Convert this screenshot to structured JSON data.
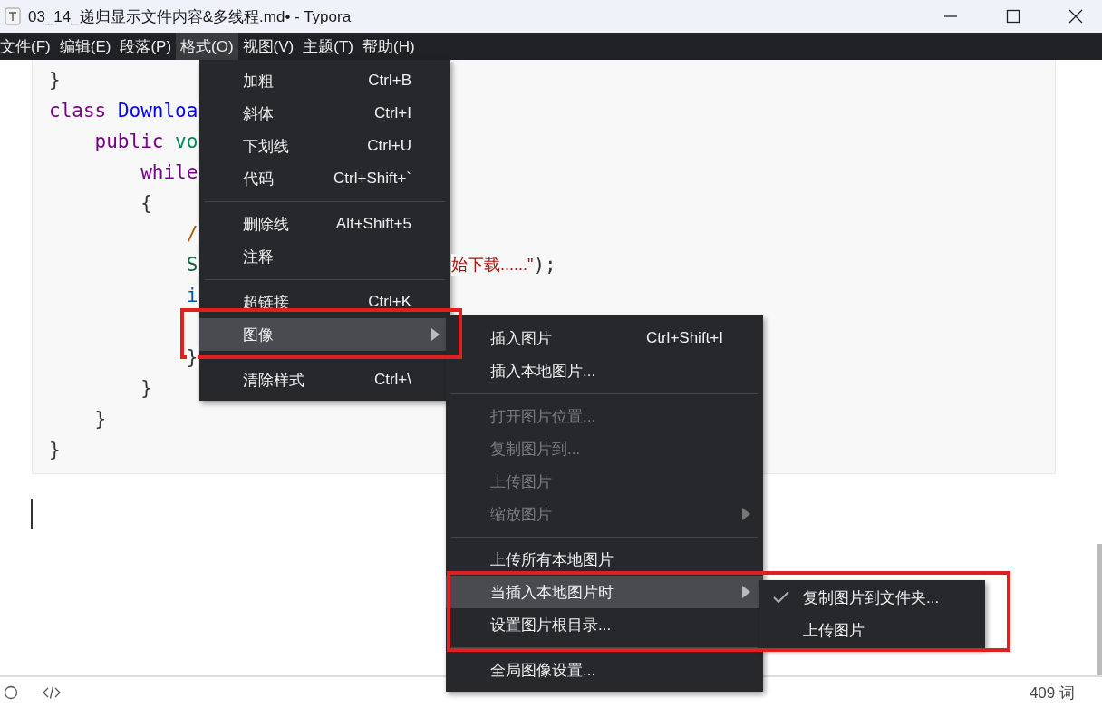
{
  "window": {
    "title": "03_14_递归显示文件内容&多线程.md• - Typora"
  },
  "menu_bar": [
    {
      "label": "文件(F)",
      "selected": false
    },
    {
      "label": "编辑(E)",
      "selected": false
    },
    {
      "label": "段落(P)",
      "selected": false
    },
    {
      "label": "格式(O)",
      "selected": true
    },
    {
      "label": "视图(V)",
      "selected": false
    },
    {
      "label": "主题(T)",
      "selected": false
    },
    {
      "label": "帮助(H)",
      "selected": false
    }
  ],
  "code_lines": [
    {
      "kind": "code",
      "tokens": [
        {
          "text": "}",
          "kind": "plain"
        }
      ]
    },
    {
      "kind": "code",
      "tokens": [
        {
          "text": "class",
          "kind": "keyword"
        },
        {
          "text": "Downloa",
          "kind": "def"
        }
      ]
    },
    {
      "kind": "code",
      "tokens": [
        {
          "text": "    public",
          "kind": "keyword"
        },
        {
          "text": "vo",
          "kind": "type"
        }
      ]
    },
    {
      "kind": "code",
      "tokens": [
        {
          "text": "        while",
          "kind": "keyword"
        }
      ]
    },
    {
      "kind": "code",
      "tokens": [
        {
          "text": "        {",
          "kind": "plain"
        }
      ]
    },
    {
      "kind": "code",
      "tokens": [
        {
          "text": "            /",
          "kind": "comment"
        }
      ]
    },
    {
      "kind": "code",
      "tokens": [
        {
          "text": "            S",
          "kind": "variable"
        }
      ],
      "tail": [
        {
          "text": "始下载......\"",
          "kind": "string"
        },
        {
          "text": ");",
          "kind": "plain"
        }
      ]
    },
    {
      "kind": "code",
      "tokens": [
        {
          "text": "            i",
          "kind": "variable2"
        }
      ]
    },
    {
      "kind": "covered"
    },
    {
      "kind": "code",
      "tokens": [
        {
          "text": "            }",
          "kind": "plain"
        }
      ]
    },
    {
      "kind": "code",
      "tokens": [
        {
          "text": "        }",
          "kind": "plain"
        }
      ]
    },
    {
      "kind": "code",
      "tokens": [
        {
          "text": "    }",
          "kind": "plain"
        }
      ]
    },
    {
      "kind": "code",
      "tokens": [
        {
          "text": "}",
          "kind": "plain"
        }
      ]
    }
  ],
  "format_menu": {
    "items": [
      {
        "kind": "item",
        "label": "加粗",
        "shortcut": "Ctrl+B",
        "selected": false,
        "submenu": false
      },
      {
        "kind": "item",
        "label": "斜体",
        "shortcut": "Ctrl+I",
        "selected": false,
        "submenu": false
      },
      {
        "kind": "item",
        "label": "下划线",
        "shortcut": "Ctrl+U",
        "selected": false,
        "submenu": false
      },
      {
        "kind": "item",
        "label": "代码",
        "shortcut": "Ctrl+Shift+`",
        "selected": false,
        "submenu": false
      },
      {
        "kind": "separator"
      },
      {
        "kind": "item",
        "label": "删除线",
        "shortcut": "Alt+Shift+5",
        "selected": false,
        "submenu": false
      },
      {
        "kind": "item",
        "label": "注释",
        "selected": false,
        "submenu": false
      },
      {
        "kind": "separator"
      },
      {
        "kind": "item",
        "label": "超链接",
        "shortcut": "Ctrl+K",
        "selected": false,
        "submenu": false
      },
      {
        "kind": "item",
        "label": "图像",
        "selected": true,
        "submenu": true
      },
      {
        "kind": "separator"
      },
      {
        "kind": "item",
        "label": "清除样式",
        "shortcut": "Ctrl+\\",
        "selected": false,
        "submenu": false
      }
    ]
  },
  "image_menu": {
    "items": [
      {
        "kind": "item",
        "label": "插入图片",
        "shortcut": "Ctrl+Shift+I",
        "selected": false,
        "disabled": false,
        "submenu": false
      },
      {
        "kind": "item",
        "label": "插入本地图片...",
        "selected": false,
        "disabled": false,
        "submenu": false
      },
      {
        "kind": "separator"
      },
      {
        "kind": "item",
        "label": "打开图片位置...",
        "selected": false,
        "disabled": true,
        "submenu": false
      },
      {
        "kind": "item",
        "label": "复制图片到...",
        "selected": false,
        "disabled": true,
        "submenu": false
      },
      {
        "kind": "item",
        "label": "上传图片",
        "selected": false,
        "disabled": true,
        "submenu": false
      },
      {
        "kind": "item",
        "label": "缩放图片",
        "selected": false,
        "disabled": true,
        "submenu": true
      },
      {
        "kind": "separator"
      },
      {
        "kind": "item",
        "label": "上传所有本地图片",
        "selected": false,
        "disabled": false,
        "submenu": false
      },
      {
        "kind": "item",
        "label": "当插入本地图片时",
        "selected": true,
        "disabled": false,
        "submenu": true
      },
      {
        "kind": "item",
        "label": "设置图片根目录...",
        "selected": false,
        "disabled": false,
        "submenu": false
      },
      {
        "kind": "separator"
      },
      {
        "kind": "item",
        "label": "全局图像设置...",
        "selected": false,
        "disabled": false,
        "submenu": false
      }
    ]
  },
  "insert_menu": {
    "items": [
      {
        "label": "复制图片到文件夹...",
        "checked": true
      },
      {
        "label": "上传图片",
        "checked": false
      }
    ]
  },
  "status_bar": {
    "word_count": "409 词"
  }
}
